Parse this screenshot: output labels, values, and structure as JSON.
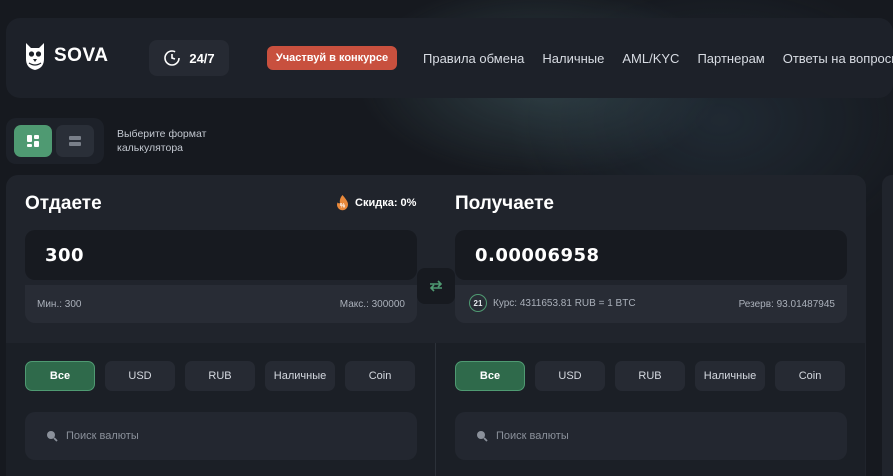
{
  "header": {
    "brand": "SOVA",
    "support": "24/7",
    "contest_button": "Участвуй в конкурсе",
    "nav": [
      "Правила обмена",
      "Наличные",
      "AML/KYC",
      "Партнерам",
      "Ответы на вопросы"
    ]
  },
  "format": {
    "label": "Выберите формат калькулятора",
    "active_color": "#4f9a72"
  },
  "give": {
    "title": "Отдаете",
    "discount": "Скидка: 0%",
    "amount": "300",
    "min": "Мин.: 300",
    "max": "Макс.: 300000",
    "tabs": [
      "Все",
      "USD",
      "RUB",
      "Наличные",
      "Coin"
    ],
    "active_tab": "Все",
    "search_placeholder": "Поиск валюты"
  },
  "receive": {
    "title": "Получаете",
    "amount": "0.00006958",
    "badge": "21",
    "rate": "Курс:  4311653.81 RUB = 1 BTC",
    "reserve": "Резерв:  93.01487945",
    "tabs": [
      "Все",
      "USD",
      "RUB",
      "Наличные",
      "Coin"
    ],
    "active_tab": "Все",
    "search_placeholder": "Поиск валюты"
  },
  "colors": {
    "accent_green": "#4f9a72",
    "contest_red": "#c8503e",
    "background": "#16191f"
  },
  "icons": {
    "logo": "owl-logo-icon",
    "support": "clock-24-icon",
    "discount": "flame-percent-icon",
    "swap": "swap-arrows-icon",
    "search": "search-icon",
    "format_grid": "grid-icon",
    "format_list": "list-icon"
  }
}
